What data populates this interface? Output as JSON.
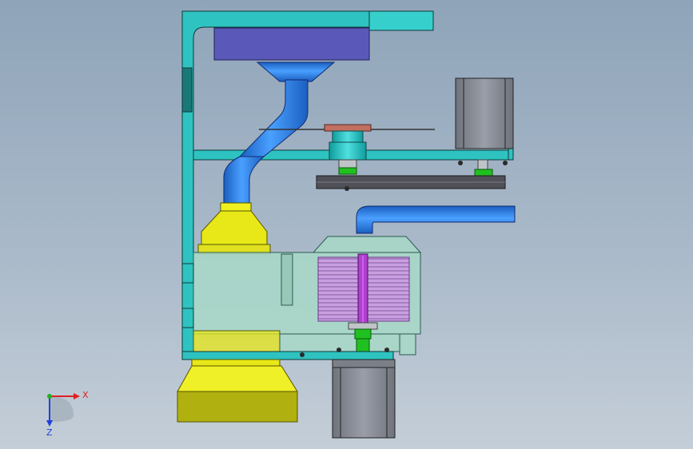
{
  "colors": {
    "frame": "#2ec3c0",
    "hopper": "#5a58b8",
    "duct": "#2f7fe0",
    "yellow": "#e8e818",
    "motor": "#8a8f9a",
    "housing": "#a8d8c8",
    "coil": "#c090d8",
    "shaft": "#b040d0",
    "green": "#20c020",
    "belt": "#505058",
    "hub": "#30c8c8",
    "axis_x": "#e02020",
    "axis_y": "#20b020",
    "axis_z": "#2040e0"
  },
  "triad": {
    "x_label": "X",
    "z_label": "Z"
  },
  "icons": [
    "coordinate-triad-icon"
  ]
}
